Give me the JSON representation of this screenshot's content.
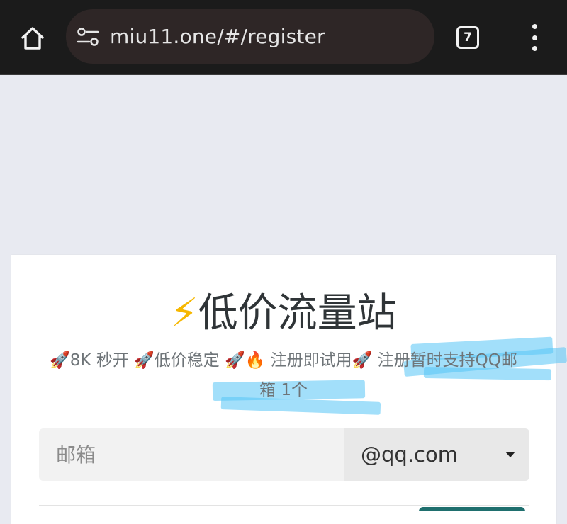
{
  "browser": {
    "url": "miu11.one/#/register",
    "tab_count": "7"
  },
  "page": {
    "title_icon": "⚡",
    "title": "低价流量站",
    "subtitle": "🚀8K 秒开 🚀低价稳定 🚀🔥 注册即试用🚀 注册暂时支持QQ邮箱 1个"
  },
  "form": {
    "email_placeholder": "邮箱",
    "email_domain": "@qq.com"
  },
  "colors": {
    "browser_bar": "#1b1b1b",
    "url_pill": "#2e2626",
    "page_bg": "#e8eaf1",
    "highlight": "#56c4f6",
    "title_text": "#2f3437"
  }
}
